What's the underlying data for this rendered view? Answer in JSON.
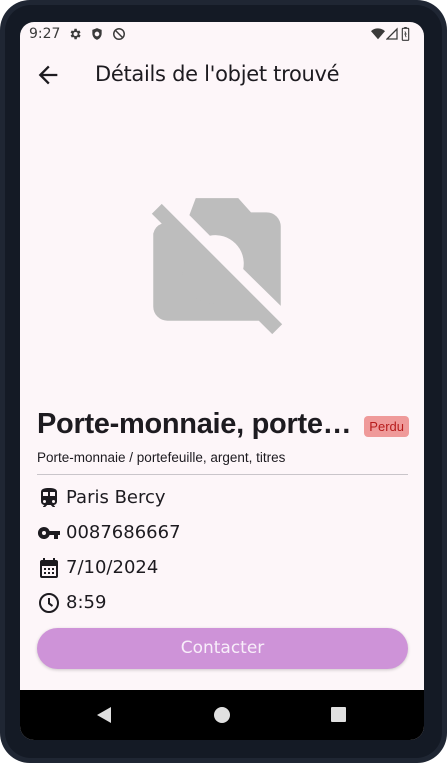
{
  "status_bar": {
    "time": "9:27",
    "left_icons": [
      "gear-icon",
      "shield-icon",
      "no-sync-icon"
    ],
    "right_icons": [
      "wifi-icon",
      "signal-icon",
      "battery-icon"
    ]
  },
  "app_bar": {
    "title": "Détails de l'objet trouvé",
    "back_icon": "arrow-back-icon"
  },
  "item": {
    "image_icon": "no-photography-icon",
    "title": "Porte-monnaie, portefeuille, argent, titres",
    "status": "Perdu",
    "category": "Porte-monnaie / portefeuille, argent, titres",
    "station": "Paris Bercy",
    "reference": "0087686667",
    "date": "7/10/2024",
    "time": "8:59"
  },
  "actions": {
    "contact_label": "Contacter"
  },
  "colors": {
    "background": "#fdf6f9",
    "badge_background": "#ef9a9a",
    "badge_text": "#b71c1c",
    "button_background": "#ce93d8",
    "placeholder_icon": "#bdbdbd"
  },
  "nav_bar": {
    "icons": [
      "nav-back-icon",
      "nav-home-icon",
      "nav-recent-icon"
    ]
  }
}
